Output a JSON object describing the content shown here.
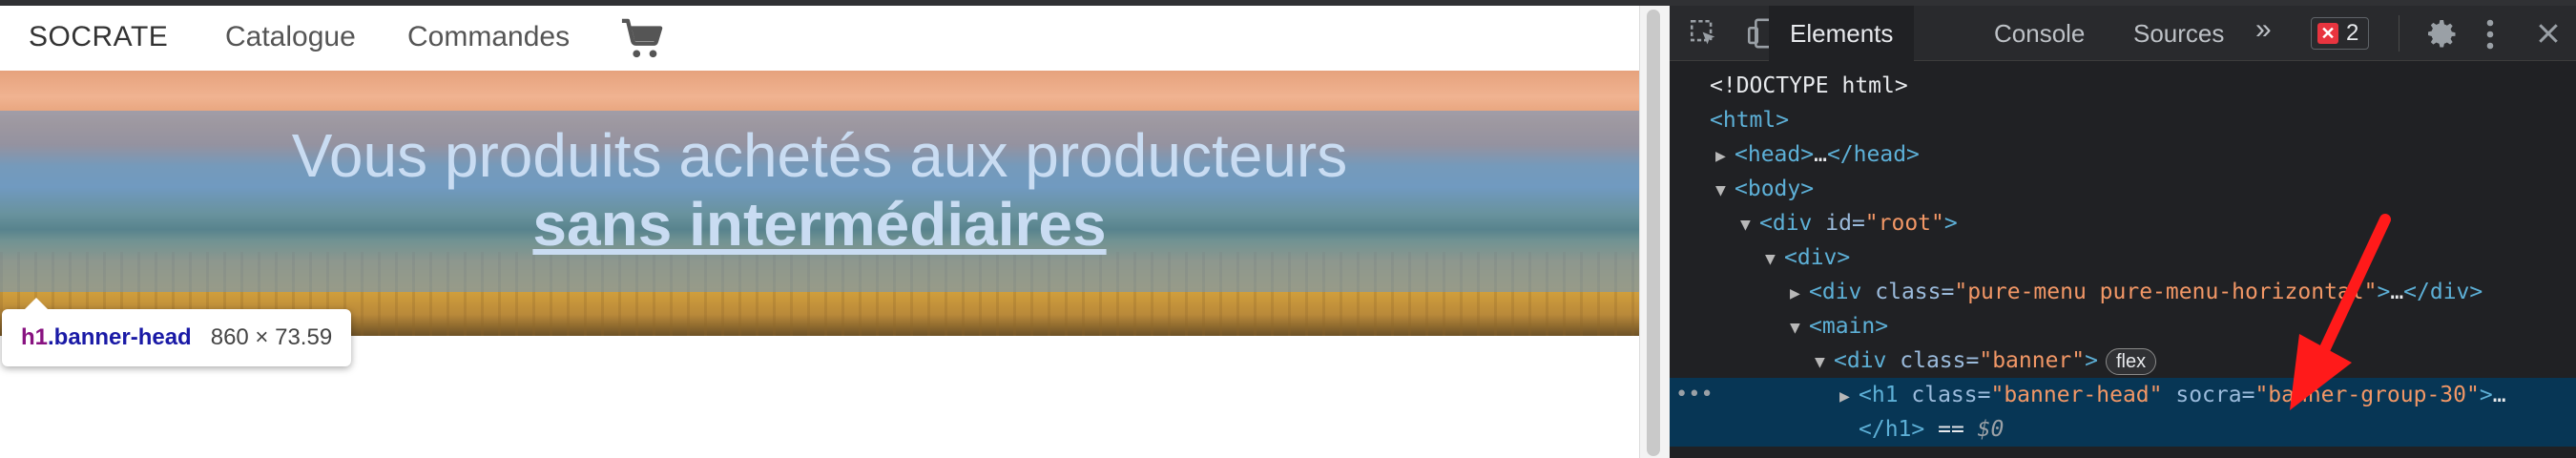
{
  "site": {
    "brand": "SOCRATE",
    "nav": [
      "Catalogue",
      "Commandes"
    ],
    "cart_icon": "shopping-cart-icon",
    "banner": {
      "line1": "Vous produits achetés aux producteurs",
      "line2": "sans intermédiaires"
    },
    "tooltip": {
      "tag": "h1",
      "class": ".banner-head",
      "size": "860 × 73.59"
    }
  },
  "devtools": {
    "tabs": [
      "Elements",
      "Console",
      "Sources"
    ],
    "active_tab": "Elements",
    "more": "»",
    "error_count": "2",
    "accent": "#e8343f",
    "dom": [
      {
        "indent": 0,
        "tri": "",
        "parts": [
          {
            "k": "plain",
            "t": "<!DOCTYPE html>"
          }
        ]
      },
      {
        "indent": 0,
        "tri": "",
        "parts": [
          {
            "k": "tag",
            "t": "<html>"
          }
        ]
      },
      {
        "indent": 1,
        "tri": "▶",
        "parts": [
          {
            "k": "tag",
            "t": "<head>"
          },
          {
            "k": "plain",
            "t": "…"
          },
          {
            "k": "tag",
            "t": "</head>"
          }
        ]
      },
      {
        "indent": 1,
        "tri": "▼",
        "parts": [
          {
            "k": "tag",
            "t": "<body>"
          }
        ]
      },
      {
        "indent": 2,
        "tri": "▼",
        "parts": [
          {
            "k": "tag",
            "t": "<div "
          },
          {
            "k": "attr",
            "t": "id="
          },
          {
            "k": "val",
            "t": "\"root\""
          },
          {
            "k": "tag",
            "t": ">"
          }
        ]
      },
      {
        "indent": 3,
        "tri": "▼",
        "parts": [
          {
            "k": "tag",
            "t": "<div>"
          }
        ]
      },
      {
        "indent": 4,
        "tri": "▶",
        "parts": [
          {
            "k": "tag",
            "t": "<div "
          },
          {
            "k": "attr",
            "t": "class="
          },
          {
            "k": "val",
            "t": "\"pure-menu pure-menu-horizontal\""
          },
          {
            "k": "tag",
            "t": ">"
          },
          {
            "k": "plain",
            "t": "…"
          },
          {
            "k": "tag",
            "t": "</div>"
          }
        ]
      },
      {
        "indent": 4,
        "tri": "▼",
        "parts": [
          {
            "k": "tag",
            "t": "<main>"
          }
        ]
      },
      {
        "indent": 5,
        "tri": "▼",
        "parts": [
          {
            "k": "tag",
            "t": "<div "
          },
          {
            "k": "attr",
            "t": "class="
          },
          {
            "k": "val",
            "t": "\"banner\""
          },
          {
            "k": "tag",
            "t": ">"
          }
        ],
        "pill": "flex"
      },
      {
        "indent": 6,
        "tri": "▶",
        "selected": true,
        "parts": [
          {
            "k": "tag",
            "t": "<h1 "
          },
          {
            "k": "attr",
            "t": "class="
          },
          {
            "k": "val",
            "t": "\"banner-head\""
          },
          {
            "k": "attr",
            "t": " socra="
          },
          {
            "k": "val",
            "t": "\"banner-group-30\""
          },
          {
            "k": "tag",
            "t": ">"
          },
          {
            "k": "plain",
            "t": "…"
          }
        ]
      },
      {
        "indent": 6,
        "tri": "",
        "selected": true,
        "parts": [
          {
            "k": "tag",
            "t": "</h1>"
          },
          {
            "k": "plain",
            "t": " == "
          },
          {
            "k": "dim",
            "t": "$0"
          }
        ]
      }
    ],
    "selected_dots": "•••"
  }
}
